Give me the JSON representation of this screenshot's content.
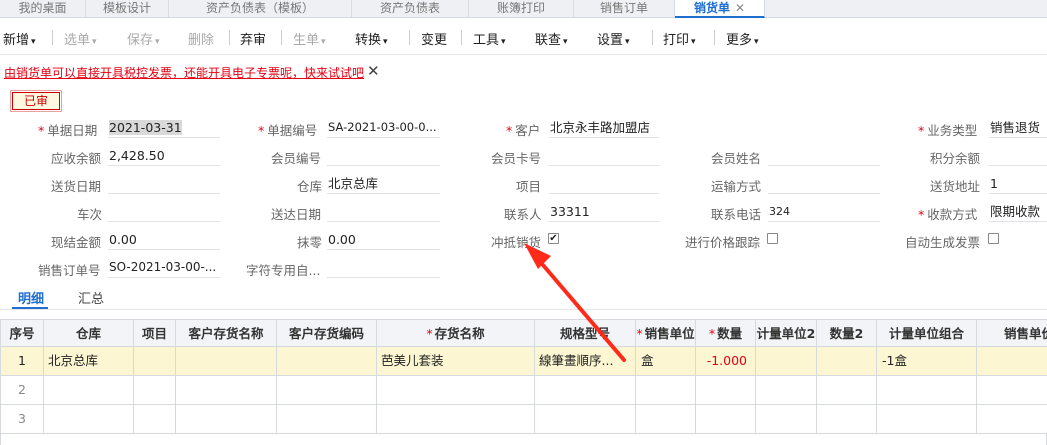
{
  "tabs": [
    {
      "label": "我的桌面"
    },
    {
      "label": "模板设计"
    },
    {
      "label": "资产负债表（模板）"
    },
    {
      "label": "资产负债表"
    },
    {
      "label": "账簿打印"
    },
    {
      "label": "销售订单"
    },
    {
      "label": "销货单",
      "close": "✕"
    }
  ],
  "toolbar": {
    "new": "新增",
    "select": "选单",
    "save": "保存",
    "delete": "删除",
    "abandon": "弃审",
    "generate": "生单",
    "convert": "转换",
    "change": "变更",
    "tools": "工具",
    "query": "联查",
    "settings": "设置",
    "print": "打印",
    "more": "更多",
    "arrow": "▾"
  },
  "notice": {
    "text": "由销货单可以直接开具税控发票，还能开具电子专票呢，快来试试吧",
    "close": "✕"
  },
  "stamp": "已审",
  "required_mark": "*",
  "form": {
    "doc_date": {
      "label": "单据日期",
      "value": "2021-03-31"
    },
    "doc_no": {
      "label": "单据编号",
      "value": "SA-2021-03-00-0..."
    },
    "customer": {
      "label": "客户",
      "value": "北京永丰路加盟店"
    },
    "biz_type": {
      "label": "业务类型",
      "value": "销售退货"
    },
    "receivable": {
      "label": "应收余额",
      "value": "2,428.50"
    },
    "member_no": {
      "label": "会员编号",
      "value": ""
    },
    "member_card": {
      "label": "会员卡号",
      "value": ""
    },
    "member_name": {
      "label": "会员姓名",
      "value": ""
    },
    "points": {
      "label": "积分余额",
      "value": ""
    },
    "delivery_date": {
      "label": "送货日期",
      "value": ""
    },
    "warehouse": {
      "label": "仓库",
      "value": "北京总库"
    },
    "project": {
      "label": "项目",
      "value": ""
    },
    "transport": {
      "label": "运输方式",
      "value": ""
    },
    "delivery_addr": {
      "label": "送货地址",
      "value": "1"
    },
    "trip": {
      "label": "车次",
      "value": ""
    },
    "arrive_date": {
      "label": "送达日期",
      "value": ""
    },
    "contact": {
      "label": "联系人",
      "value": "33311"
    },
    "phone": {
      "label": "联系电话",
      "value": "324"
    },
    "pay_method": {
      "label": "收款方式",
      "value": "限期收款"
    },
    "cash_amount": {
      "label": "现结金额",
      "value": "0.00"
    },
    "erase": {
      "label": "抹零",
      "value": "0.00"
    },
    "offset": {
      "label": "冲抵销货",
      "checked": "✔"
    },
    "price_track": {
      "label": "进行价格跟踪"
    },
    "auto_invoice": {
      "label": "自动生成发票"
    },
    "so_no": {
      "label": "销售订单号",
      "value": "SO-2021-03-00-..."
    },
    "char_custom": {
      "label": "字符专用自...",
      "value": ""
    }
  },
  "subtabs": {
    "detail": "明细",
    "summary": "汇总"
  },
  "grid": {
    "headers": {
      "seq": "序号",
      "warehouse": "仓库",
      "project": "项目",
      "cust_name": "客户存货名称",
      "cust_code": "客户存货编码",
      "inv_name": "存货名称",
      "spec": "规格型号",
      "unit": "销售单位",
      "qty": "数量",
      "unit2": "计量单位2",
      "qty2": "数量2",
      "unit_combo": "计量单位组合",
      "sale_unit_cut": "销售单价"
    },
    "rows": [
      {
        "seq": "1",
        "warehouse": "北京总库",
        "inv_name": "芭美儿套装",
        "spec": "線筆畫順序...",
        "unit": "盒",
        "qty": "-1.000",
        "unit_combo": "-1盒"
      },
      {
        "seq": "2"
      },
      {
        "seq": "3"
      }
    ]
  }
}
